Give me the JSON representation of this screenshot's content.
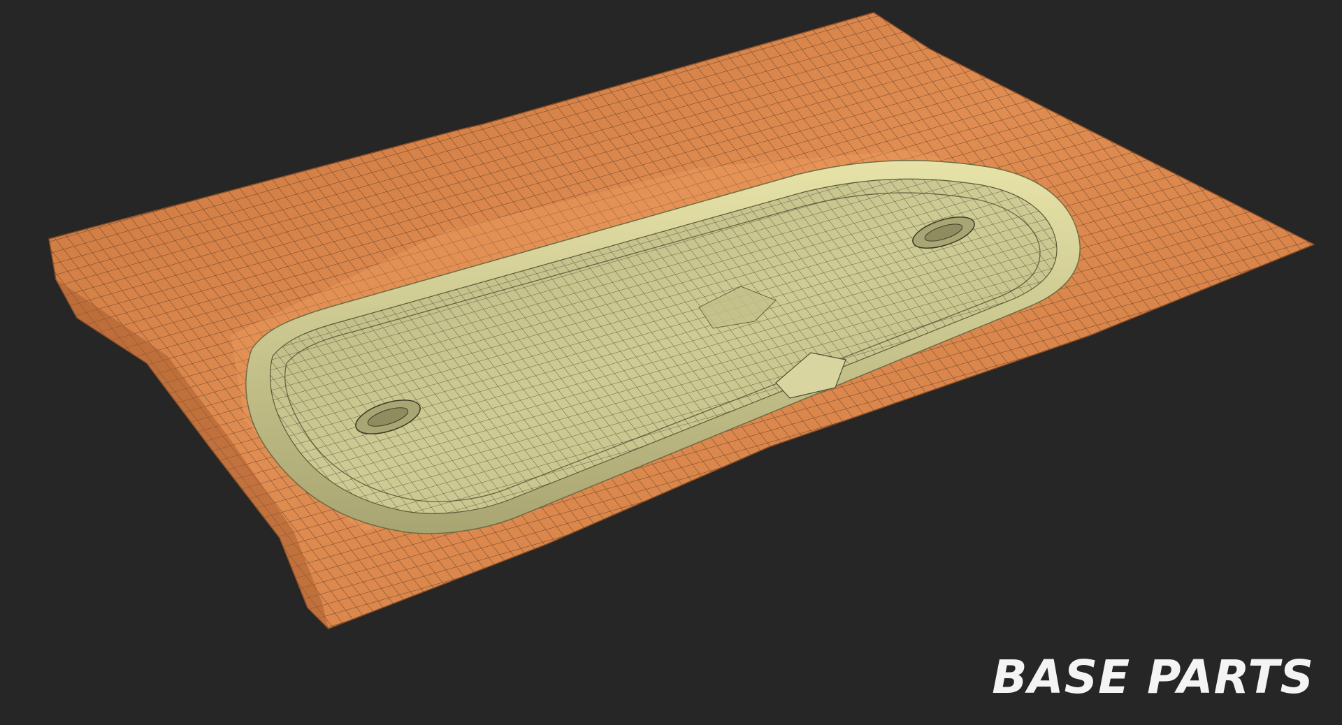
{
  "caption": "BASE PARTS",
  "colors": {
    "background": "#262626",
    "outer_part": "#d9834a",
    "inner_part": "#c9c590",
    "mesh_lines": "#2a2015"
  }
}
